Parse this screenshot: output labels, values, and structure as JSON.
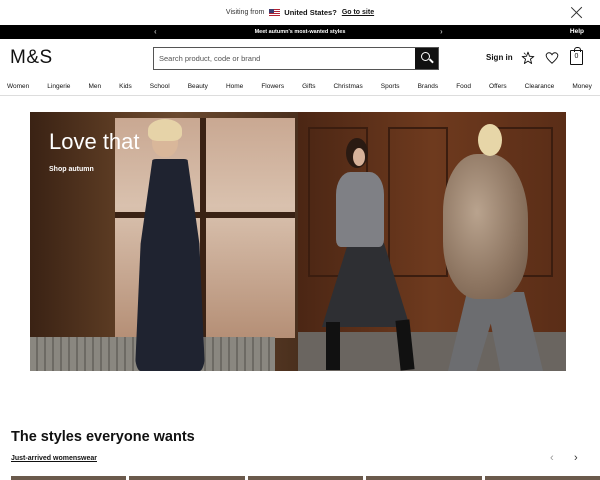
{
  "visiting": {
    "label": "Visiting from",
    "country": "United States?",
    "goto_label": "Go to site"
  },
  "promo": {
    "text": "Meet autumn's most-wanted styles",
    "help": "Help"
  },
  "header": {
    "logo": "M&S",
    "search_placeholder": "Search product, code or brand",
    "signin": "Sign in",
    "bag_count": "0"
  },
  "nav": {
    "items": [
      "Women",
      "Lingerie",
      "Men",
      "Kids",
      "School",
      "Beauty",
      "Home",
      "Flowers",
      "Gifts",
      "Christmas",
      "Sports",
      "Brands",
      "Food",
      "Offers",
      "Clearance",
      "Money"
    ]
  },
  "hero": {
    "title": "Love that",
    "link": "Shop autumn"
  },
  "section": {
    "title": "The styles everyone wants",
    "link": "Just-arrived womenswear"
  },
  "colors": {
    "promo_bg": "#000000",
    "text": "#111111"
  }
}
